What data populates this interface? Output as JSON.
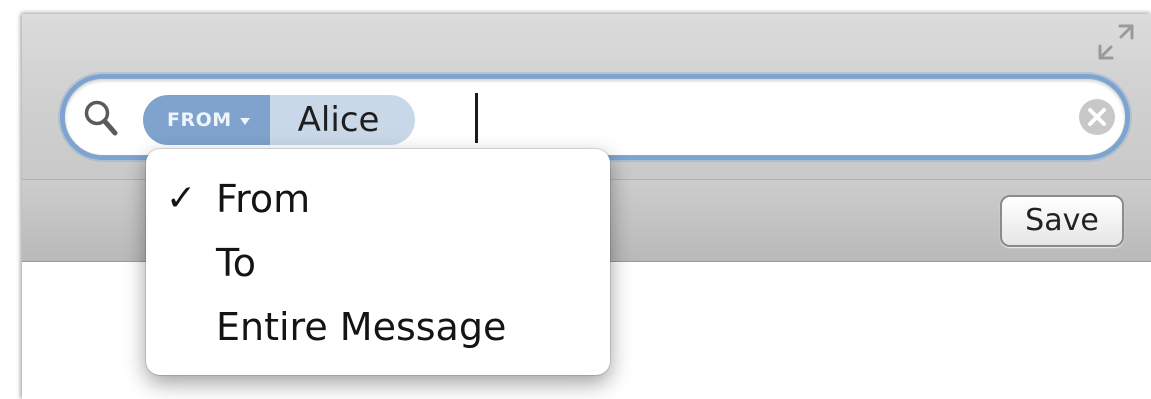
{
  "search": {
    "token_type_label": "FROM",
    "token_value": "Alice",
    "input_value": ""
  },
  "dropdown": {
    "checkmark_glyph": "✓",
    "items": [
      {
        "label": "From",
        "checked": true
      },
      {
        "label": "To",
        "checked": false
      },
      {
        "label": "Entire Message",
        "checked": false
      }
    ]
  },
  "toolbar": {
    "save_label": "Save"
  },
  "colors": {
    "focus_ring": "#7ca3d2",
    "token_type_bg": "#7fa3cd",
    "token_value_bg": "#c9d8e8"
  },
  "icons": {
    "search": "search-icon",
    "clear": "clear-icon",
    "fullscreen": "fullscreen-icon",
    "dropdown": "dropdown-arrow-icon",
    "check": "checkmark-icon"
  }
}
